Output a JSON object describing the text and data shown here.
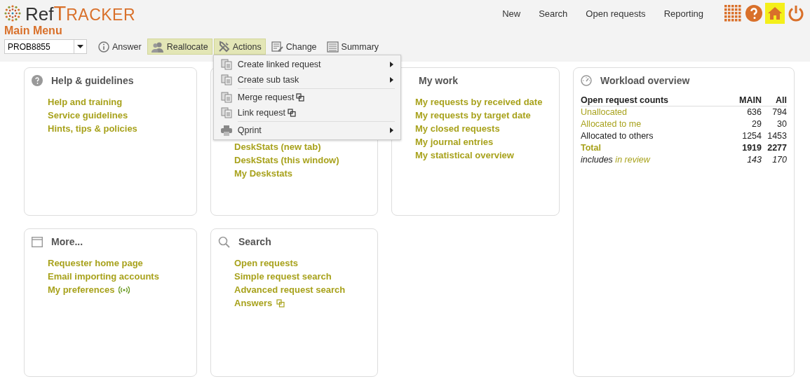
{
  "logo": {
    "part1": "Ref",
    "part2": "T",
    "part3": "RACKER"
  },
  "nav": [
    "New",
    "Search",
    "Open requests",
    "Reporting"
  ],
  "page_title": "Main Menu",
  "request_select": {
    "value": "PROB8855"
  },
  "toolbar": [
    {
      "label": "Answer",
      "selected": false
    },
    {
      "label": "Reallocate",
      "selected": true
    },
    {
      "label": "Actions",
      "selected": true
    },
    {
      "label": "Change",
      "selected": false
    },
    {
      "label": "Summary",
      "selected": false
    }
  ],
  "actions_menu": [
    {
      "items": [
        {
          "label": "Create linked request",
          "kind": "submenu"
        },
        {
          "label": "Create sub task",
          "kind": "submenu"
        }
      ]
    },
    {
      "items": [
        {
          "label": "Merge request",
          "kind": "popout"
        },
        {
          "label": "Link request",
          "kind": "popout"
        }
      ]
    },
    {
      "items": [
        {
          "label": "Qprint",
          "kind": "submenu"
        }
      ]
    }
  ],
  "cards": [
    {
      "title": "Help & guidelines",
      "links": [
        {
          "label": "Help and training"
        },
        {
          "label": "Service guidelines"
        },
        {
          "label": "Hints, tips & policies"
        }
      ]
    },
    {
      "links": [
        {
          "label": "DeskStats (new tab)"
        },
        {
          "label": "DeskStats (this window)"
        },
        {
          "label": "My Deskstats"
        }
      ]
    },
    {
      "title": "My work",
      "links": [
        {
          "label": "My requests by received date"
        },
        {
          "label": "My requests by target date"
        },
        {
          "label": "My closed requests"
        },
        {
          "label": "My journal entries"
        },
        {
          "label": "My statistical overview"
        }
      ]
    },
    {
      "title": "More...",
      "links": [
        {
          "label": "Requester home page"
        },
        {
          "label": "Email importing accounts"
        },
        {
          "label": "My preferences",
          "kind": "broadcast"
        }
      ]
    },
    {
      "title": "Search",
      "links": [
        {
          "label": "Open requests"
        },
        {
          "label": "Simple request search"
        },
        {
          "label": "Advanced request search"
        },
        {
          "label": "Answers",
          "kind": "popout"
        }
      ]
    }
  ],
  "workload": {
    "title": "Workload overview",
    "columns": [
      "Open request counts",
      "MAIN",
      "All"
    ],
    "rows": [
      {
        "kind": "link",
        "label": "Unallocated",
        "main": "636",
        "all": "794"
      },
      {
        "kind": "link",
        "label": "Allocated to me",
        "main": "29",
        "all": "30"
      },
      {
        "kind": "plain",
        "label": "Allocated to others",
        "main": "1254",
        "all": "1453"
      },
      {
        "kind": "total",
        "label": "Total",
        "main": "1919",
        "all": "2277"
      },
      {
        "kind": "note",
        "label": "includes",
        "link": "in review",
        "main": "143",
        "all": "170"
      }
    ]
  }
}
